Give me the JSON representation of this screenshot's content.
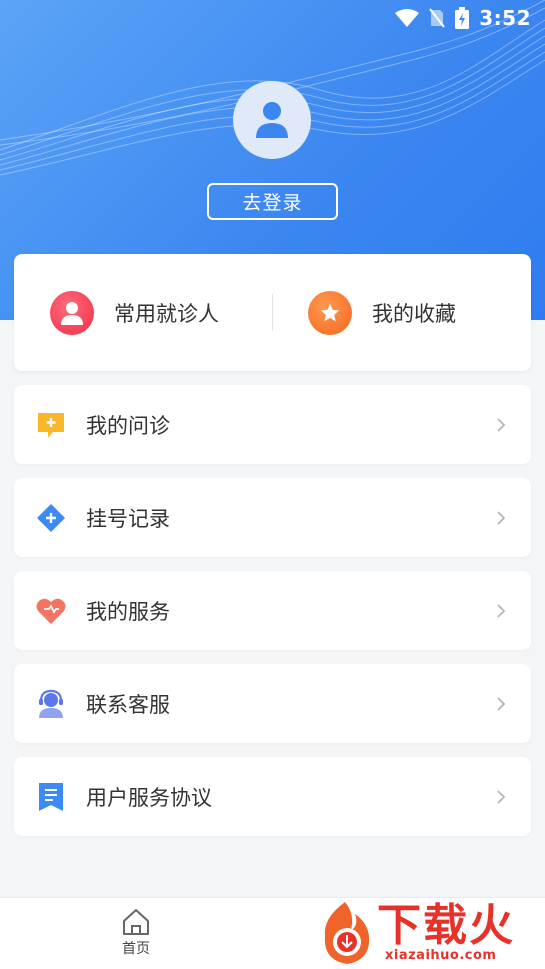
{
  "status_bar": {
    "time": "3:52",
    "icons": [
      "wifi-icon",
      "no-sim-icon",
      "battery-charging-icon"
    ]
  },
  "profile": {
    "avatar_icon": "user-icon",
    "login_label": "去登录"
  },
  "quick_actions": [
    {
      "label": "常用就诊人",
      "icon": "person-icon",
      "color": "#f2384f"
    },
    {
      "label": "我的收藏",
      "icon": "star-icon",
      "color": "#f6692a"
    }
  ],
  "menu": [
    {
      "label": "我的问诊",
      "icon": "consult-chat-icon",
      "color": "#f8b82a"
    },
    {
      "label": "挂号记录",
      "icon": "register-diamond-icon",
      "color": "#3d8bf2"
    },
    {
      "label": "我的服务",
      "icon": "heart-icon",
      "color": "#f47462"
    },
    {
      "label": "联系客服",
      "icon": "customer-service-icon",
      "color": "#5a78e8"
    },
    {
      "label": "用户服务协议",
      "icon": "document-icon",
      "color": "#3d8bf2"
    }
  ],
  "tabbar": {
    "home_label": "首页",
    "home_icon": "home-icon"
  },
  "watermark": {
    "text": "下载火",
    "url": "xiazaihuo.com"
  },
  "colors": {
    "header_start": "#5ba4f7",
    "header_end": "#2f7cf0",
    "accent": "#e7322a"
  }
}
